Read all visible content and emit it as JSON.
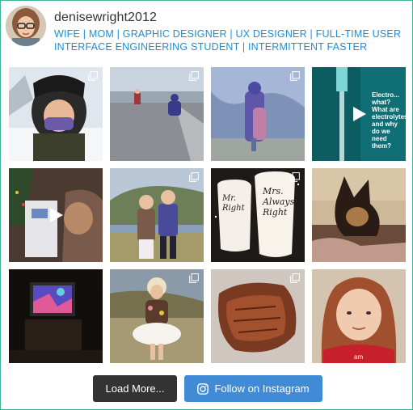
{
  "profile": {
    "username": "denisewright2012",
    "bio": "WIFE | MOM | GRAPHIC DESIGNER | UX DESIGNER | FULL-TIME USER INTERFACE ENGINEERING STUDENT | INTERMITTENT FASTER"
  },
  "posts": [
    {
      "id": "post-1",
      "type": "carousel"
    },
    {
      "id": "post-2",
      "type": "carousel"
    },
    {
      "id": "post-3",
      "type": "carousel"
    },
    {
      "id": "post-4",
      "type": "video",
      "overlay_text": "Electro... what? What are electrolytes and why do we need them?"
    },
    {
      "id": "post-5",
      "type": "video"
    },
    {
      "id": "post-6",
      "type": "carousel"
    },
    {
      "id": "post-7",
      "type": "carousel",
      "mug_left": "Mr. Right",
      "mug_right": "Mrs. Always Right"
    },
    {
      "id": "post-8",
      "type": "image"
    },
    {
      "id": "post-9",
      "type": "image"
    },
    {
      "id": "post-10",
      "type": "carousel"
    },
    {
      "id": "post-11",
      "type": "carousel"
    },
    {
      "id": "post-12",
      "type": "image",
      "shirt_text": "am"
    }
  ],
  "buttons": {
    "load_more": "Load More...",
    "follow": "Follow on Instagram"
  },
  "colors": {
    "border": "#3fb39a",
    "bio": "#1c8fd6",
    "load_more_bg": "#333333",
    "follow_bg": "#418bd6"
  },
  "icons": {
    "carousel": "multi-image-icon",
    "video": "play-icon",
    "follow": "instagram-icon"
  }
}
